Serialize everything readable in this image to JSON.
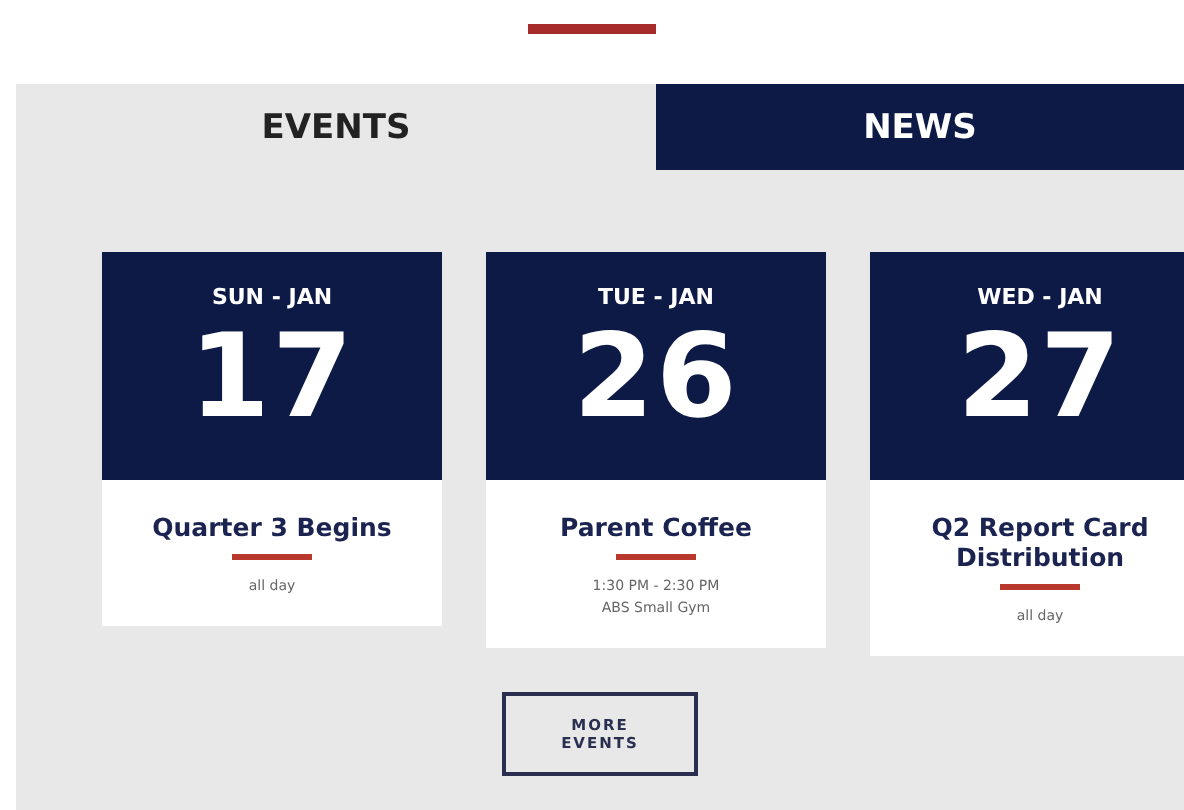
{
  "tabs": [
    {
      "label": "EVENTS",
      "selected": true
    },
    {
      "label": "NEWS",
      "selected": false
    }
  ],
  "events": [
    {
      "day": "SUN - JAN",
      "date": "17",
      "title": "Quarter 3 Begins",
      "details": [
        "all day"
      ]
    },
    {
      "day": "TUE - JAN",
      "date": "26",
      "title": "Parent Coffee",
      "details": [
        "1:30 PM - 2:30 PM",
        "ABS Small Gym"
      ]
    },
    {
      "day": "WED - JAN",
      "date": "27",
      "title": "Q2 Report Card Distribution",
      "details": [
        "all day"
      ]
    }
  ],
  "more_button": "MORE EVENTS"
}
